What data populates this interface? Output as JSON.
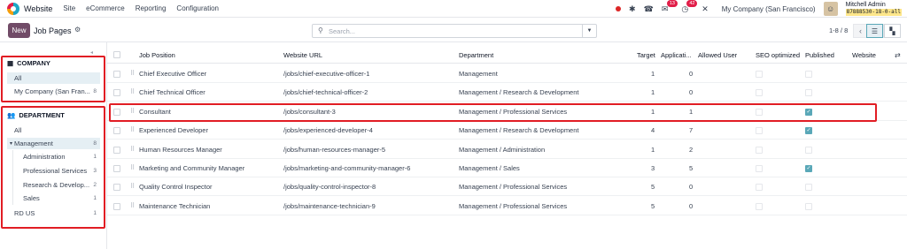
{
  "topbar": {
    "app_name": "Website",
    "menu": [
      "Site",
      "eCommerce",
      "Reporting",
      "Configuration"
    ],
    "messages_count": "13",
    "activities_count": "42",
    "company": "My Company (San Francisco)",
    "user_name": "Mitchell Admin",
    "db_name": "87888530-18-0-all"
  },
  "control": {
    "new_label": "New",
    "title": "Job Pages",
    "search_placeholder": "Search...",
    "pager": "1-8 / 8"
  },
  "sidebar": {
    "company_title": "COMPANY",
    "company_items": [
      {
        "label": "All",
        "count": ""
      },
      {
        "label": "My Company (San Fran...",
        "count": "8"
      }
    ],
    "department_title": "DEPARTMENT",
    "department_items": [
      {
        "label": "All",
        "count": ""
      },
      {
        "label": "Management",
        "count": "8"
      },
      {
        "label": "Administration",
        "count": "1"
      },
      {
        "label": "Professional Services",
        "count": "3"
      },
      {
        "label": "Research & Develop...",
        "count": "2"
      },
      {
        "label": "Sales",
        "count": "1"
      },
      {
        "label": "RD US",
        "count": "1"
      }
    ]
  },
  "table": {
    "headers": {
      "job_position": "Job Position",
      "website_url": "Website URL",
      "department": "Department",
      "target": "Target",
      "applications": "Applicati...",
      "allowed_user": "Allowed User",
      "seo": "SEO optimized",
      "published": "Published",
      "website": "Website"
    },
    "rows": [
      {
        "job": "Chief Executive Officer",
        "url": "/jobs/chief-executive-officer-1",
        "dept": "Management",
        "target": "1",
        "apps": "0",
        "published": false
      },
      {
        "job": "Chief Technical Officer",
        "url": "/jobs/chief-technical-officer-2",
        "dept": "Management / Research & Development",
        "target": "1",
        "apps": "0",
        "published": false
      },
      {
        "job": "Consultant",
        "url": "/jobs/consultant-3",
        "dept": "Management / Professional Services",
        "target": "1",
        "apps": "1",
        "published": true
      },
      {
        "job": "Experienced Developer",
        "url": "/jobs/experienced-developer-4",
        "dept": "Management / Research & Development",
        "target": "4",
        "apps": "7",
        "published": true
      },
      {
        "job": "Human Resources Manager",
        "url": "/jobs/human-resources-manager-5",
        "dept": "Management / Administration",
        "target": "1",
        "apps": "2",
        "published": false
      },
      {
        "job": "Marketing and Community Manager",
        "url": "/jobs/marketing-and-community-manager-6",
        "dept": "Management / Sales",
        "target": "3",
        "apps": "5",
        "published": true
      },
      {
        "job": "Quality Control Inspector",
        "url": "/jobs/quality-control-inspector-8",
        "dept": "Management / Professional Services",
        "target": "5",
        "apps": "0",
        "published": false
      },
      {
        "job": "Maintenance Technician",
        "url": "/jobs/maintenance-technician-9",
        "dept": "Management / Professional Services",
        "target": "5",
        "apps": "0",
        "published": false
      }
    ]
  },
  "colors": {
    "brand": "#714b67",
    "highlight_border": "#e11d24",
    "checkbox_on": "#5aa8b8"
  }
}
